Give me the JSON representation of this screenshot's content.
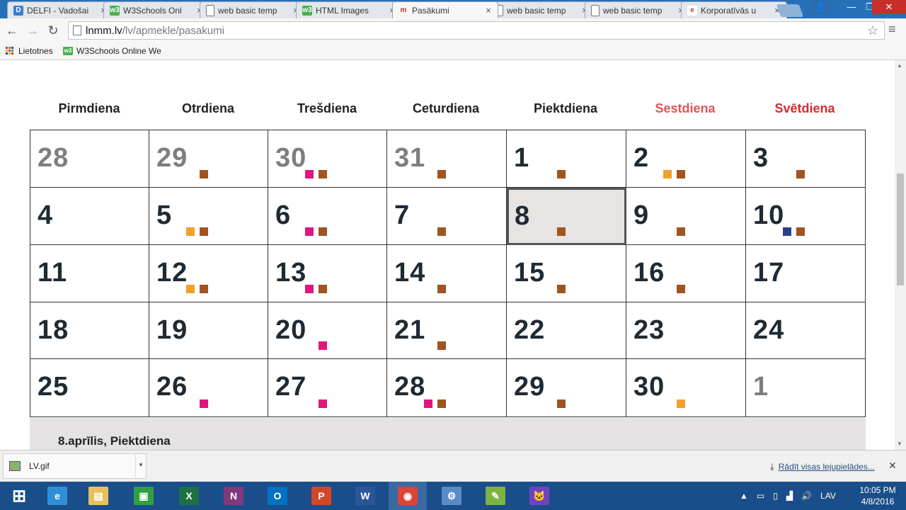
{
  "browser": {
    "tabs": [
      {
        "title": "DELFI - Vadošai",
        "icon": "delfi-icon",
        "icon_color": "#3b7fd6",
        "icon_glyph": "D",
        "active": false
      },
      {
        "title": "W3Schools Onl",
        "icon": "w3schools-icon",
        "icon_color": "#4caf50",
        "icon_glyph": "w3",
        "active": false
      },
      {
        "title": "web basic temp",
        "icon": "page-icon",
        "icon_color": "#ffffff",
        "icon_glyph": "",
        "active": false
      },
      {
        "title": "HTML Images",
        "icon": "w3schools-icon",
        "icon_color": "#4caf50",
        "icon_glyph": "w3",
        "active": false
      },
      {
        "title": "Pasākumi",
        "icon": "lnmm-icon",
        "icon_color": "#f6f6f6",
        "icon_glyph": "m",
        "active": true
      },
      {
        "title": "web basic temp",
        "icon": "page-icon",
        "icon_color": "#ffffff",
        "icon_glyph": "",
        "active": false
      },
      {
        "title": "web basic temp",
        "icon": "page-icon",
        "icon_color": "#ffffff",
        "icon_glyph": "",
        "active": false
      },
      {
        "title": "Korporatīvās u",
        "icon": "e-icon",
        "icon_color": "#ffffff",
        "icon_glyph": "e",
        "active": false
      }
    ],
    "tab_close_glyph": "×",
    "window_controls": {
      "user": "👤",
      "minimize": "—",
      "maximize": "❐",
      "close": "✕"
    },
    "url_host": "lnmm.lv",
    "url_path": "/lv/apmekle/pasakumi",
    "star_glyph": "☆",
    "menu_glyph": "≡",
    "back_glyph": "←",
    "forward_glyph": "→",
    "reload_glyph": "↻"
  },
  "bookmarks": {
    "apps_label": "Lietotnes",
    "items": [
      {
        "label": "W3Schools Online We"
      }
    ]
  },
  "calendar": {
    "weekdays": [
      {
        "label": "Pirmdiena",
        "kind": "weekday"
      },
      {
        "label": "Otrdiena",
        "kind": "weekday"
      },
      {
        "label": "Trešdiena",
        "kind": "weekday"
      },
      {
        "label": "Ceturdiena",
        "kind": "weekday"
      },
      {
        "label": "Piektdiena",
        "kind": "weekday"
      },
      {
        "label": "Sestdiena",
        "kind": "saturday"
      },
      {
        "label": "Svētdiena",
        "kind": "sunday"
      }
    ],
    "event_colors": {
      "brown": "#a0541f",
      "orange": "#f0a02c",
      "pink": "#e0157f",
      "blue": "#2b3f8f"
    },
    "weeks": [
      [
        {
          "day": "28",
          "other": true,
          "dots": []
        },
        {
          "day": "29",
          "other": true,
          "dots": [
            "brown"
          ]
        },
        {
          "day": "30",
          "other": true,
          "dots": [
            "pink",
            "brown"
          ]
        },
        {
          "day": "31",
          "other": true,
          "dots": [
            "brown"
          ]
        },
        {
          "day": "1",
          "other": false,
          "dots": [
            "brown"
          ]
        },
        {
          "day": "2",
          "other": false,
          "dots": [
            "orange",
            "brown"
          ]
        },
        {
          "day": "3",
          "other": false,
          "dots": [
            "brown"
          ]
        }
      ],
      [
        {
          "day": "4",
          "other": false,
          "dots": []
        },
        {
          "day": "5",
          "other": false,
          "dots": [
            "orange",
            "brown"
          ]
        },
        {
          "day": "6",
          "other": false,
          "dots": [
            "pink",
            "brown"
          ]
        },
        {
          "day": "7",
          "other": false,
          "dots": [
            "brown"
          ]
        },
        {
          "day": "8",
          "other": false,
          "selected": true,
          "dots": [
            "brown"
          ]
        },
        {
          "day": "9",
          "other": false,
          "dots": [
            "brown"
          ]
        },
        {
          "day": "10",
          "other": false,
          "dots": [
            "blue",
            "brown"
          ]
        }
      ],
      [
        {
          "day": "11",
          "other": false,
          "dots": []
        },
        {
          "day": "12",
          "other": false,
          "dots": [
            "orange",
            "brown"
          ]
        },
        {
          "day": "13",
          "other": false,
          "dots": [
            "pink",
            "brown"
          ]
        },
        {
          "day": "14",
          "other": false,
          "dots": [
            "brown"
          ]
        },
        {
          "day": "15",
          "other": false,
          "dots": [
            "brown"
          ]
        },
        {
          "day": "16",
          "other": false,
          "dots": [
            "brown"
          ]
        },
        {
          "day": "17",
          "other": false,
          "dots": []
        }
      ],
      [
        {
          "day": "18",
          "other": false,
          "dots": []
        },
        {
          "day": "19",
          "other": false,
          "dots": []
        },
        {
          "day": "20",
          "other": false,
          "dots": [
            "pink"
          ]
        },
        {
          "day": "21",
          "other": false,
          "dots": [
            "brown"
          ]
        },
        {
          "day": "22",
          "other": false,
          "dots": []
        },
        {
          "day": "23",
          "other": false,
          "dots": []
        },
        {
          "day": "24",
          "other": false,
          "dots": []
        }
      ],
      [
        {
          "day": "25",
          "other": false,
          "dots": []
        },
        {
          "day": "26",
          "other": false,
          "dots": [
            "pink"
          ]
        },
        {
          "day": "27",
          "other": false,
          "dots": [
            "pink"
          ]
        },
        {
          "day": "28",
          "other": false,
          "dots": [
            "pink",
            "brown"
          ]
        },
        {
          "day": "29",
          "other": false,
          "dots": [
            "brown"
          ]
        },
        {
          "day": "30",
          "other": false,
          "dots": [
            "orange"
          ]
        },
        {
          "day": "1",
          "other": true,
          "dots": []
        }
      ]
    ],
    "selected_date_title": "8.aprīlis, Piektdiena"
  },
  "downloads": {
    "file_name": "LV.gif",
    "caret_glyph": "▾",
    "show_all_label": "Rādīt visas lejupielādes...",
    "close_glyph": "✕"
  },
  "taskbar": {
    "apps": [
      {
        "name": "windows-start",
        "glyph": "⊞",
        "color": "#1a4e8a"
      },
      {
        "name": "internet-explorer",
        "glyph": "e",
        "color": "#2e8ed8"
      },
      {
        "name": "file-explorer",
        "glyph": "▤",
        "color": "#e8c15a"
      },
      {
        "name": "store",
        "glyph": "▣",
        "color": "#2ea043"
      },
      {
        "name": "excel",
        "glyph": "X",
        "color": "#1e7145"
      },
      {
        "name": "onenote",
        "glyph": "N",
        "color": "#80397b"
      },
      {
        "name": "outlook",
        "glyph": "O",
        "color": "#0072c6"
      },
      {
        "name": "powerpoint",
        "glyph": "P",
        "color": "#d24726"
      },
      {
        "name": "word",
        "glyph": "W",
        "color": "#2b579a"
      },
      {
        "name": "chrome",
        "glyph": "◉",
        "color": "#db4437",
        "active": true
      },
      {
        "name": "control-panel",
        "glyph": "⚙",
        "color": "#5b8bc7"
      },
      {
        "name": "notepad",
        "glyph": "✎",
        "color": "#7cb342"
      },
      {
        "name": "github-desktop",
        "glyph": "🐱",
        "color": "#6f42c1"
      }
    ],
    "language": "LAV",
    "time": "10:05 PM",
    "date": "4/8/2016"
  }
}
